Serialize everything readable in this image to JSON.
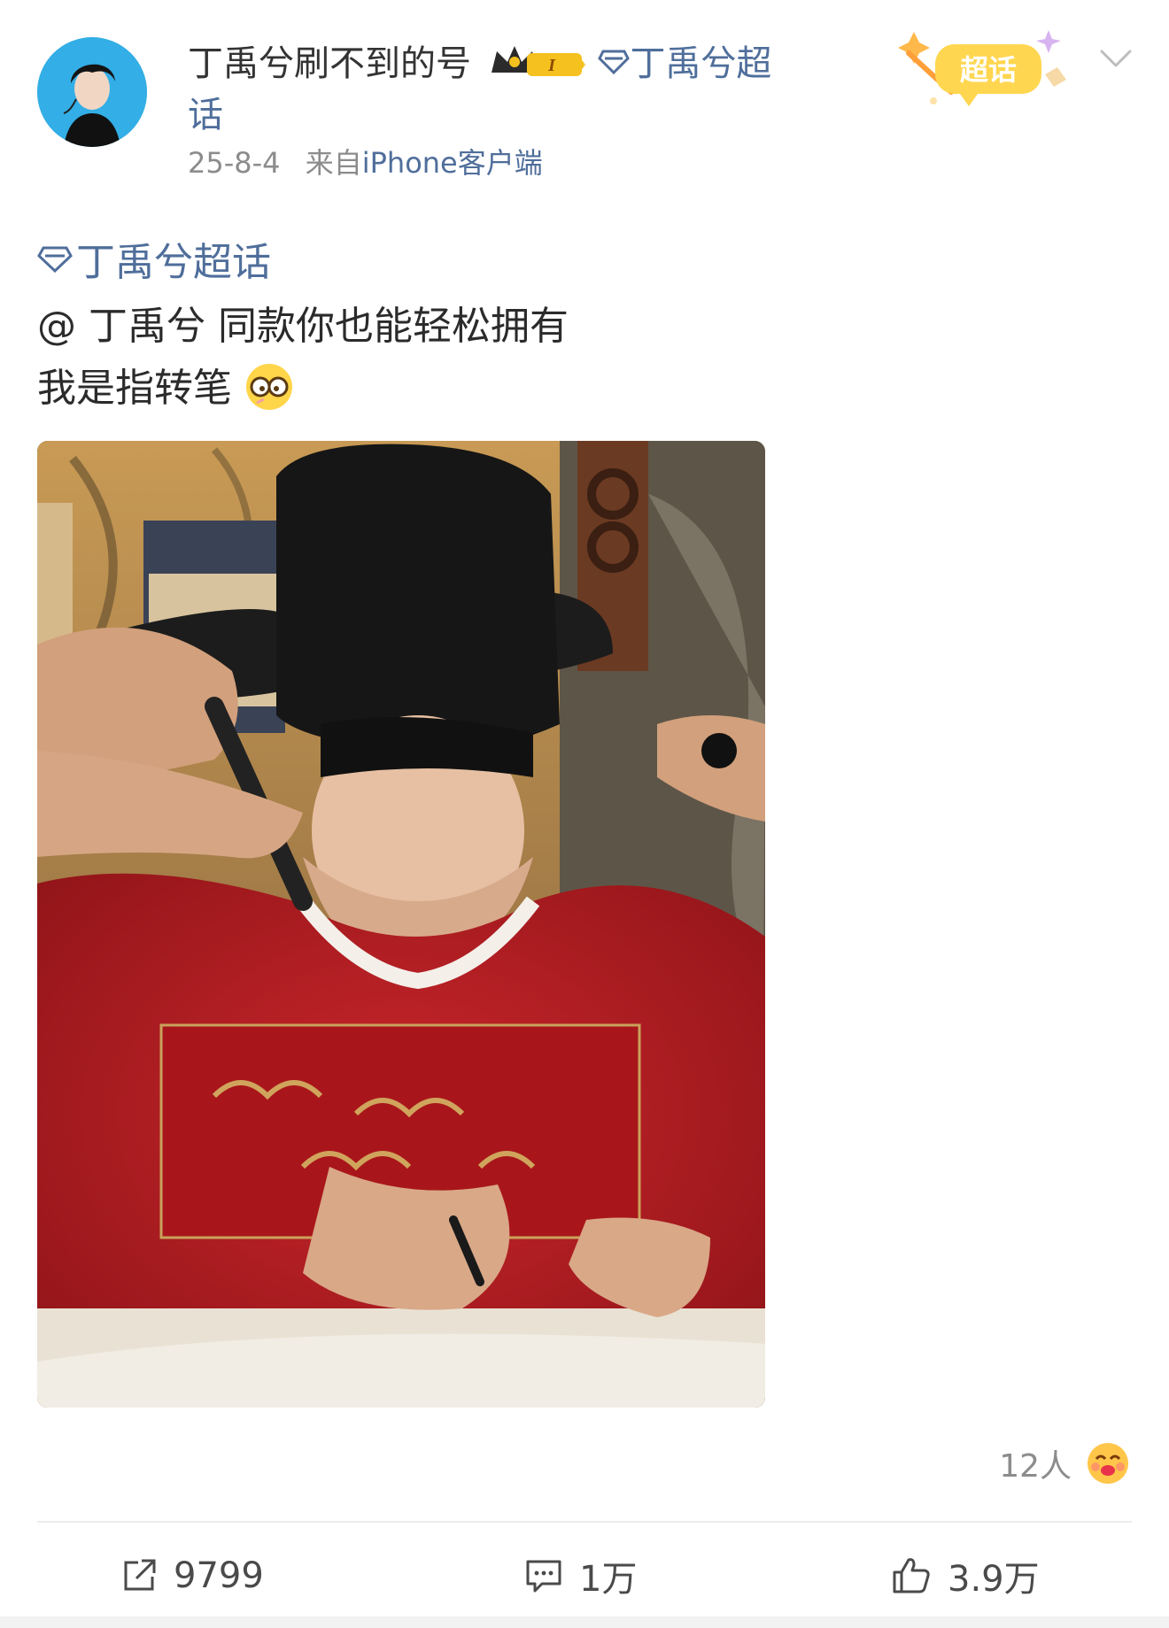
{
  "post": {
    "author": {
      "name": "丁禹兮刷不到的号",
      "badge_text": "I"
    },
    "topic_tag": "丁禹兮超话",
    "topic_tag_wrap_last": "话",
    "topic_tag_first_line": "丁禹兮超",
    "time": "25-8-4",
    "source_prefix": "来自",
    "source_device": "iPhone客户端",
    "super_topic_badge_label": "超话",
    "body": {
      "topic": "丁禹兮超话",
      "line1": "@ 丁禹兮 同款你也能轻松拥有",
      "line2": "我是指转笔"
    },
    "reaction_count": "12人",
    "actions": {
      "repost": "9799",
      "comment": "1万",
      "like": "3.9万"
    }
  },
  "colors": {
    "link": "#4f6e9b",
    "meta": "#8c8c8c",
    "badge_gold": "#f5c11e",
    "robe_red": "#b31d22"
  },
  "icons": {
    "repost": "repost-icon",
    "comment": "comment-icon",
    "like": "thumbs-up-icon",
    "more": "chevron-down-icon",
    "topic": "diamond-icon"
  }
}
